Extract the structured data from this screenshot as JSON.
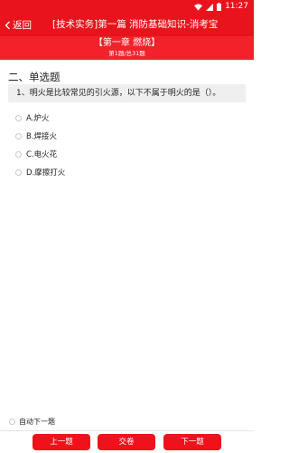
{
  "status_bar": {
    "time": "11:27",
    "icons": [
      "wifi-icon",
      "signal-icon",
      "battery-icon"
    ]
  },
  "nav": {
    "back_label": "返回",
    "title": "[技术实务]第一篇 消防基础知识-消考宝"
  },
  "chapter": {
    "title": "【第一章 燃烧】",
    "progress": "第1题/总31题"
  },
  "section": {
    "title": "二、单选题"
  },
  "question": {
    "text": "1、明火是比较常见的引火源，以下不属于明火的是（）。"
  },
  "options": [
    {
      "label": "A.炉火"
    },
    {
      "label": "B.焊接火"
    },
    {
      "label": "C.电火花"
    },
    {
      "label": "D.摩擦打火"
    }
  ],
  "auto_next": {
    "label": "自动下一题",
    "checked": false
  },
  "footer": {
    "prev_label": "上一题",
    "submit_label": "交卷",
    "next_label": "下一题"
  },
  "colors": {
    "brand_red": "#e8131c",
    "button_red": "#f0111a"
  }
}
